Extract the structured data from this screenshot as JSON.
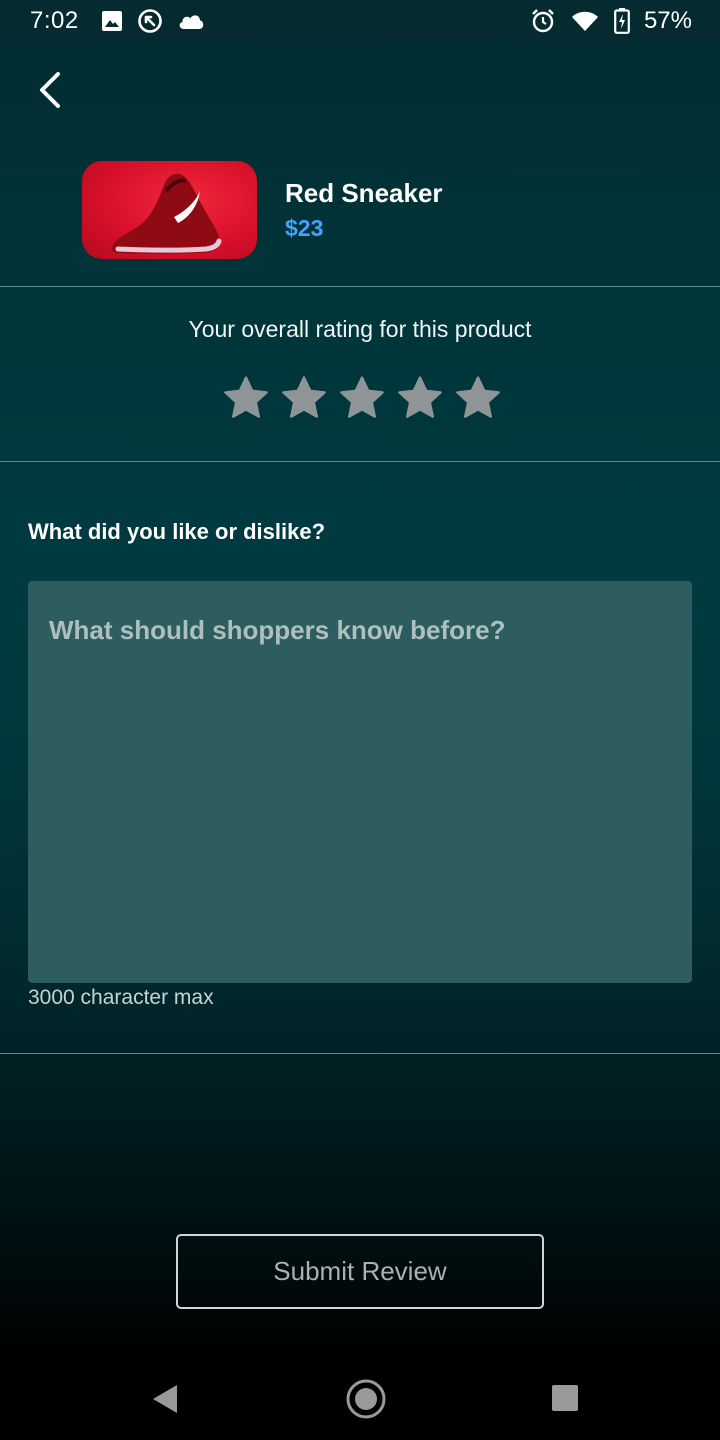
{
  "status_bar": {
    "time": "7:02",
    "battery": "57%",
    "icons_left": [
      "image-icon",
      "sync-icon",
      "cloud-icon"
    ],
    "icons_right": [
      "alarm-icon",
      "wifi-icon",
      "battery-charging-icon"
    ]
  },
  "header": {
    "back_icon": "chevron-left-icon"
  },
  "product": {
    "name": "Red Sneaker",
    "price": "$23"
  },
  "rating": {
    "label": "Your overall rating for this product",
    "stars": 5,
    "selected": 0,
    "star_color": "#8f9596"
  },
  "review": {
    "title": "What did you like or dislike?",
    "placeholder": "What should shoppers know before?",
    "value": "",
    "char_limit_label": "3000 character max"
  },
  "actions": {
    "submit_label": "Submit Review"
  },
  "colors": {
    "price": "#3fa3ff",
    "input_background": "#2e5d60",
    "product_thumb": "#d9102a"
  },
  "nav_bar": {
    "icons": [
      "back-triangle-icon",
      "home-circle-icon",
      "recents-square-icon"
    ]
  }
}
